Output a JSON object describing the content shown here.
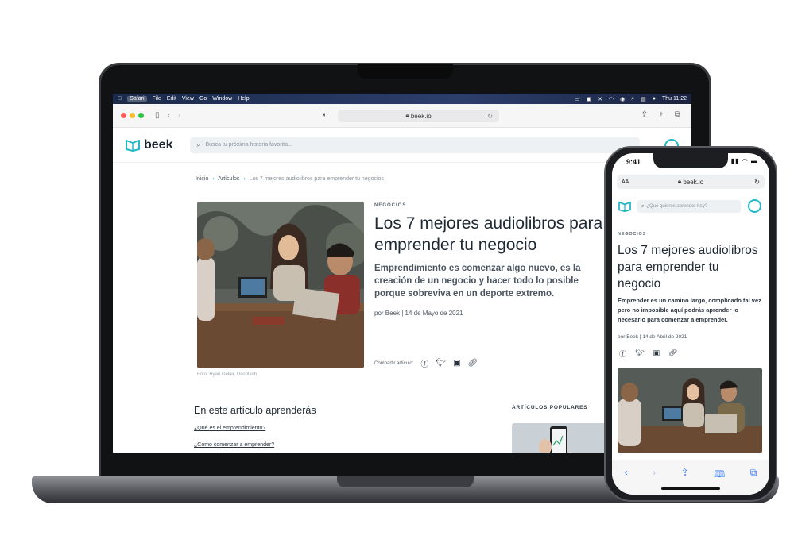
{
  "menubar": {
    "app": "Safari",
    "items": [
      "File",
      "Edit",
      "View",
      "Go",
      "Window",
      "Help"
    ],
    "clock": "Thu 11:22"
  },
  "browser": {
    "url": "beek.io"
  },
  "site": {
    "logo": "beek",
    "search_placeholder": "Busca tu próxima historia favorita..."
  },
  "breadcrumb": {
    "home": "Inicio",
    "section": "Artículos",
    "current": "Los 7 mejores audiolibros para emprender tu negocios"
  },
  "article": {
    "category": "NEGOCIOS",
    "title": "Los 7 mejores audiolibros para emprender tu negocio",
    "lead": "Emprendimiento es comenzar algo nuevo, es la creación de un negocio y hacer todo lo posible porque sobreviva en un deporte extremo.",
    "byline": "por Beek  |  14 de Mayo de 2021",
    "photo_credit": "Foto: Ryan Geller, Unsplash",
    "share_label": "Compartir artículo:"
  },
  "toc": {
    "title": "En este artículo aprenderás",
    "links": [
      "¿Qué es el emprendimiento?",
      "¿Cómo comenzar a emprender?"
    ]
  },
  "popular": {
    "title": "ARTÍCULOS POPULARES"
  },
  "phone": {
    "time": "9:41",
    "url": "beek.io",
    "aa": "AA",
    "search_placeholder": "¿Qué quieres aprender hoy?",
    "category": "NEGOCIOS",
    "title": "Los 7 mejores audiolibros para emprender tu negocio",
    "lead": "Emprender es un camino largo, complicado tal vez pero no imposible aquí podrás aprender lo necesario para comenzar a emprender.",
    "byline": "por Beek | 14 de Abril de 2021"
  },
  "colors": {
    "accent": "#22b8c8",
    "text": "#1f2933"
  }
}
